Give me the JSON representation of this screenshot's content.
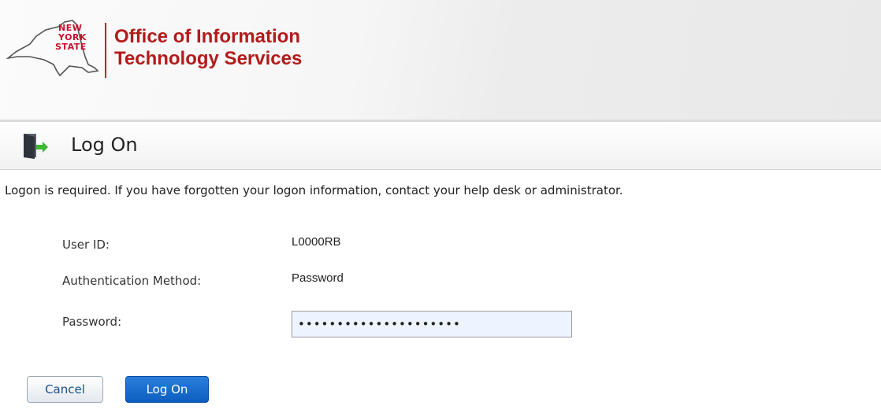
{
  "header": {
    "state_lines": [
      "NEW",
      "YORK",
      "STATE"
    ],
    "agency_line1": "Office of Information",
    "agency_line2": "Technology Services",
    "brand_color": "#c8102e"
  },
  "page": {
    "title": "Log On",
    "title_icon": "logon-door-icon",
    "info": "Logon is required. If you have forgotten your logon information, contact your help desk or administrator."
  },
  "form": {
    "user_id_label": "User ID:",
    "user_id_value": "L0000RB",
    "auth_method_label": "Authentication Method:",
    "auth_method_value": "Password",
    "password_label": "Password:",
    "password_value": "•••••••••••••••••••••"
  },
  "buttons": {
    "cancel": "Cancel",
    "logon": "Log On",
    "accent": "#0c5dbf"
  }
}
